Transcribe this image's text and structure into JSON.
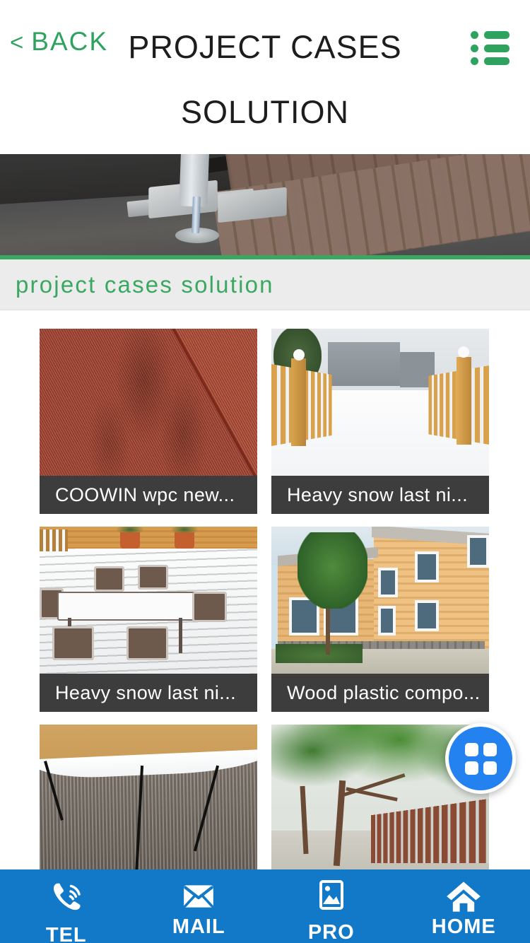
{
  "header": {
    "back_chevron": "<",
    "back_label": "BACK",
    "title_line1": "PROJECT CASES",
    "title_line2": "SOLUTION",
    "menu_icon": "list-menu-icon",
    "accent_green": "#2ea35f"
  },
  "banner": {
    "alt": "wpc decking board installation with hidden clip and screwdriver"
  },
  "section": {
    "title": "project cases solution",
    "rule_color": "#3aa860",
    "background": "#ececec",
    "text_color": "#3aa860"
  },
  "grid": {
    "cards": [
      {
        "caption": "COOWIN wpc new...",
        "alt": "red and black wpc decking boards wood grain"
      },
      {
        "caption": "Heavy snow last ni...",
        "alt": "snow covered path between wooden picket fences"
      },
      {
        "caption": "Heavy snow last ni...",
        "alt": "snow covered patio table and chairs on decking"
      },
      {
        "caption": "Wood plastic compo...",
        "alt": "building clad with wood plastic composite siding"
      },
      {
        "caption": "",
        "alt": "grooved composite decking with melting snow"
      },
      {
        "caption": "",
        "alt": "brown composite picket fence with green trees"
      }
    ]
  },
  "fab": {
    "icon": "grid-squares-icon",
    "color": "#2481f0",
    "label": ""
  },
  "bottom_nav": {
    "background": "#1279c9",
    "items": [
      {
        "icon": "phone-icon",
        "label": "TEL"
      },
      {
        "icon": "mail-icon",
        "label": "MAIL"
      },
      {
        "icon": "image-icon",
        "label": "PRO"
      },
      {
        "icon": "home-icon",
        "label": "HOME"
      }
    ]
  }
}
